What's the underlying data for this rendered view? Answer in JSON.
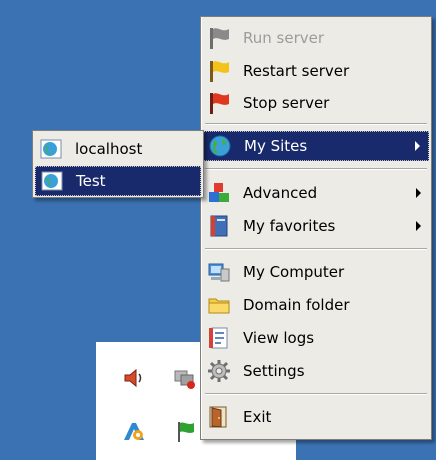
{
  "menu": {
    "items": [
      {
        "label": "Run server",
        "icon": "gray-flag-icon",
        "disabled": true
      },
      {
        "label": "Restart server",
        "icon": "yellow-flag-icon"
      },
      {
        "label": "Stop server",
        "icon": "red-flag-icon"
      },
      {
        "label": "My Sites",
        "icon": "globe-icon",
        "submenu": true,
        "selected": true
      },
      {
        "label": "Advanced",
        "icon": "blocks-icon",
        "submenu": true
      },
      {
        "label": "My favorites",
        "icon": "book-icon",
        "submenu": true
      },
      {
        "label": "My Computer",
        "icon": "computer-icon"
      },
      {
        "label": "Domain folder",
        "icon": "folder-icon"
      },
      {
        "label": "View logs",
        "icon": "log-icon"
      },
      {
        "label": "Settings",
        "icon": "gear-icon"
      },
      {
        "label": "Exit",
        "icon": "door-icon"
      }
    ]
  },
  "submenu": {
    "items": [
      {
        "label": "localhost",
        "icon": "site-icon"
      },
      {
        "label": "Test",
        "icon": "site-icon",
        "selected": true
      }
    ]
  },
  "tray": {
    "icons": [
      "speaker-icon",
      "network-icon",
      "app-icon",
      "green-flag-icon"
    ]
  },
  "colors": {
    "desktop": "#3b72b3",
    "menu_bg": "#ecebe5",
    "selection": "#192a6c"
  }
}
